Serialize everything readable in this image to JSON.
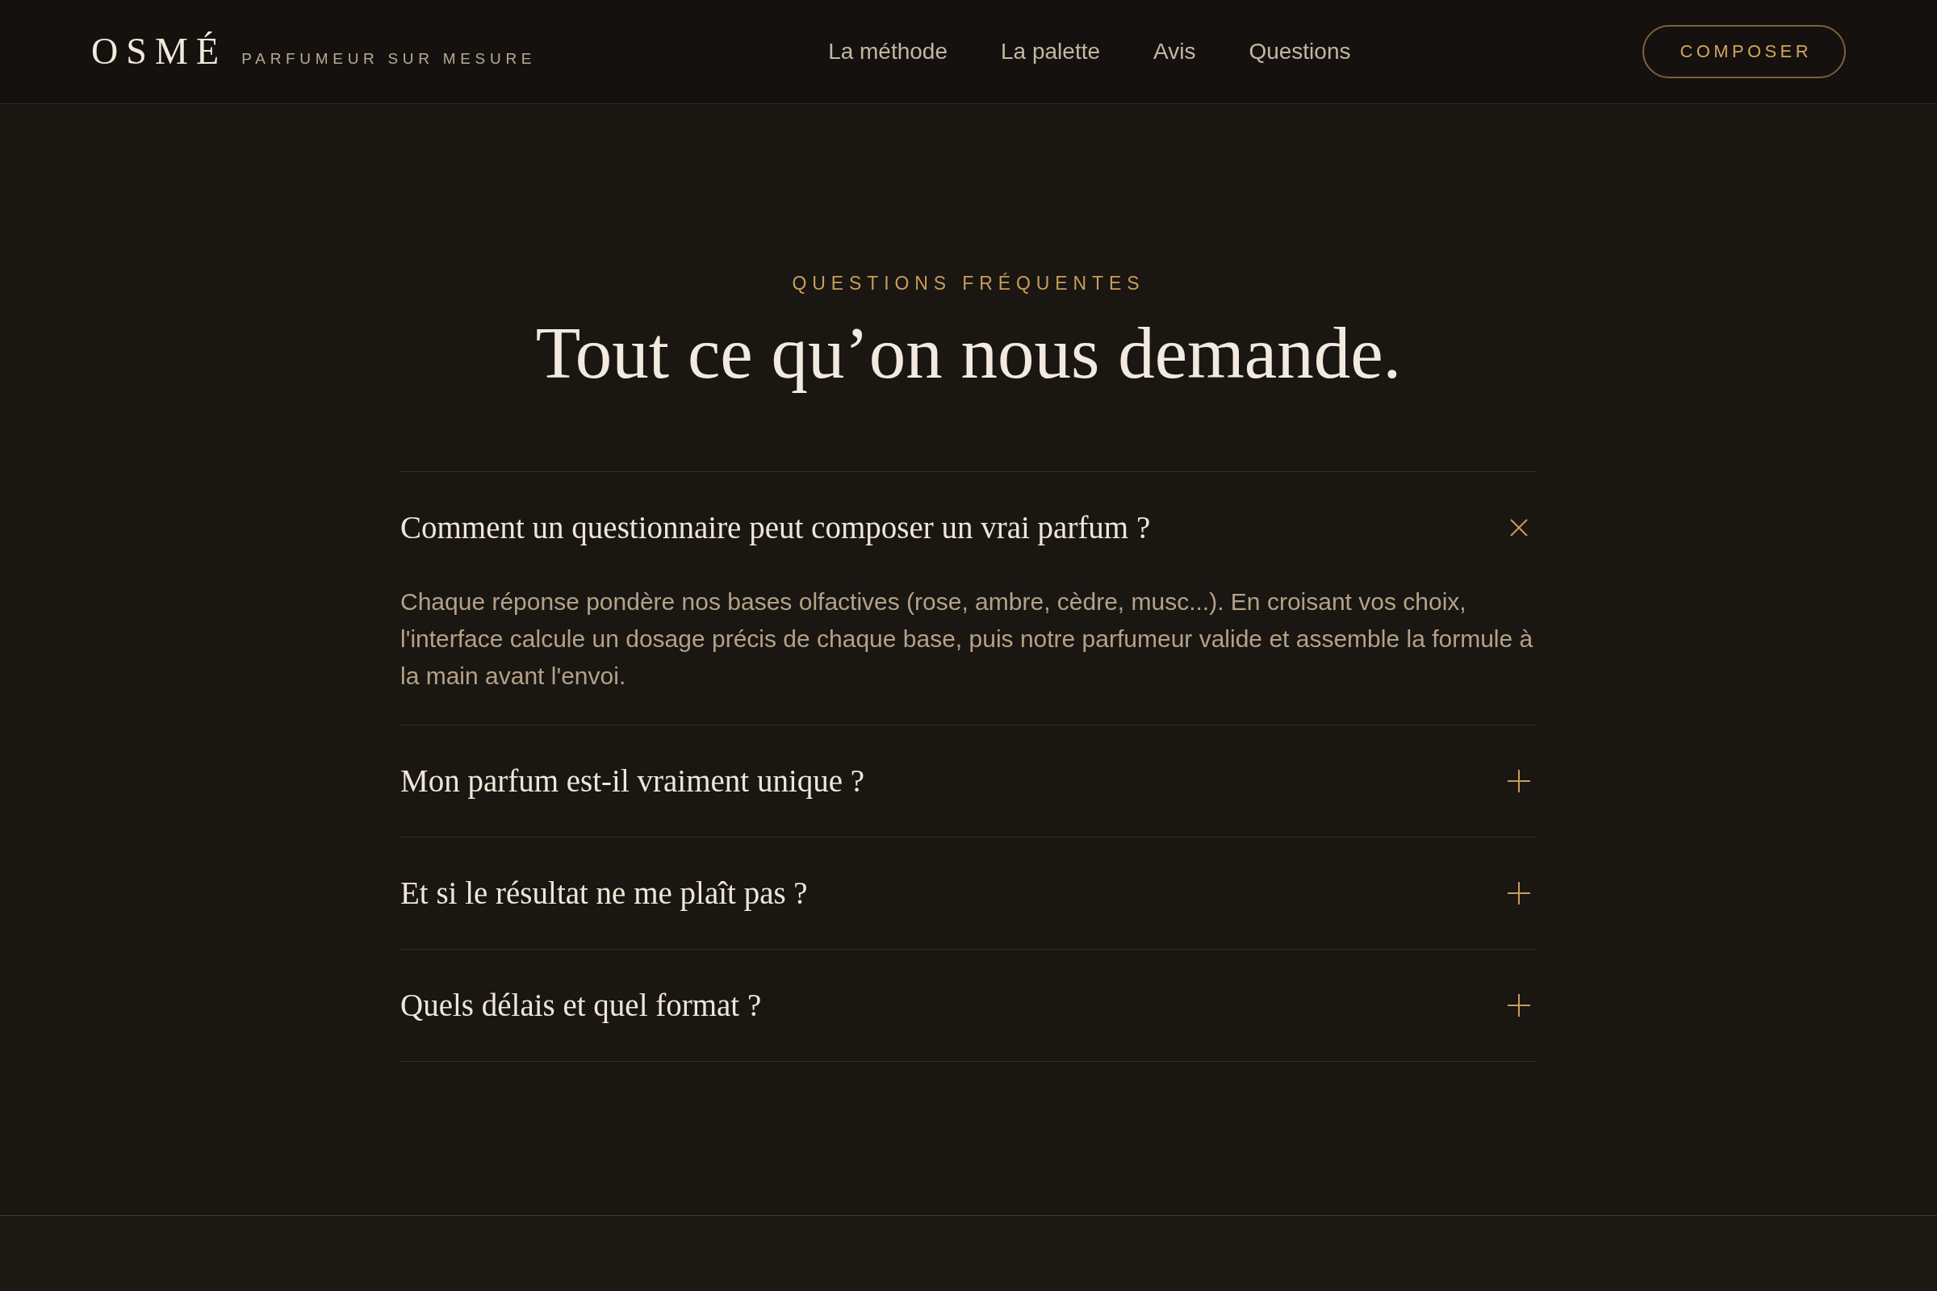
{
  "header": {
    "logo": "OSMÉ",
    "tagline": "PARFUMEUR SUR MESURE",
    "nav": [
      "La méthode",
      "La palette",
      "Avis",
      "Questions"
    ],
    "cta": "COMPOSER"
  },
  "faq": {
    "eyebrow": "QUESTIONS FRÉQUENTES",
    "title": "Tout ce qu’on nous demande.",
    "items": [
      {
        "question": "Comment un questionnaire peut composer un vrai parfum ?",
        "expanded": true,
        "answer": "Chaque réponse pondère nos bases olfactives (rose, ambre, cèdre, musc...). En croisant vos choix, l'interface calcule un dosage précis de chaque base, puis notre parfumeur valide et assemble la formule à la main avant l'envoi."
      },
      {
        "question": "Mon parfum est-il vraiment unique ?",
        "expanded": false
      },
      {
        "question": "Et si le résultat ne me plaît pas ?",
        "expanded": false
      },
      {
        "question": "Quels délais et quel format ?",
        "expanded": false
      }
    ]
  }
}
